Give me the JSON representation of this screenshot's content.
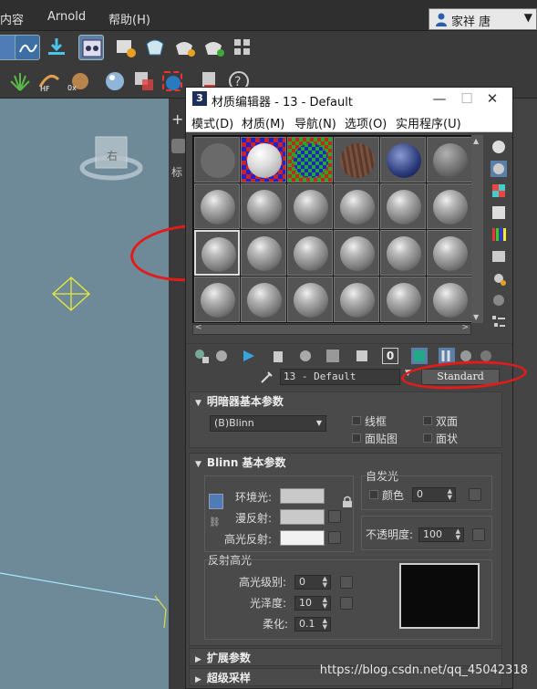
{
  "app_menu": {
    "items": [
      "内容",
      "Arnold",
      "帮助(H)"
    ]
  },
  "user": {
    "name": "家祥 唐",
    "icon": "user-icon",
    "caret": "▼"
  },
  "toolbar1": {
    "icons": [
      "schematic-view-icon",
      "curve-editor-icon",
      "layer-explorer-icon",
      "material-editor-icon",
      "render-setup-icon",
      "rendered-frame-window-icon",
      "render-icon",
      "render-iterative-icon",
      "render-to-texture-icon"
    ]
  },
  "toolbar2": {
    "icons": [
      "foliage-icon",
      "hair-fur-icon",
      "cloth-icon",
      "sphere-material-icon",
      "material-map-icon",
      "render-sphere-icon",
      "box-select-icon",
      "batch-render-icon",
      "help-icon"
    ]
  },
  "viewport": {
    "cube_label": "右"
  },
  "material_editor": {
    "title": "材质编辑器 - 13 - Default",
    "app_icon_text": "3",
    "window_controls": {
      "minimize": "—",
      "maximize": "☐",
      "close": "✕"
    },
    "menu": [
      "模式(D)",
      "材质(M)",
      "导航(N)",
      "选项(O)",
      "实用程序(U)"
    ],
    "material_name": "13 - Default",
    "material_type": "Standard",
    "shader_section": {
      "title": "明暗器基本参数",
      "shader_value": "(B)Blinn",
      "checkboxes": [
        "线框",
        "双面",
        "面贴图",
        "面状"
      ]
    },
    "blinn_section": {
      "title": "Blinn 基本参数",
      "ambient_label": "环境光:",
      "diffuse_label": "漫反射:",
      "specular_label": "高光反射:",
      "self_illum_title": "自发光",
      "color_label": "颜色",
      "color_value": "0",
      "opacity_label": "不透明度:",
      "opacity_value": "100",
      "spec_highlights_title": "反射高光",
      "spec_level_label": "高光级别:",
      "spec_level_value": "0",
      "glossiness_label": "光泽度:",
      "glossiness_value": "10",
      "soften_label": "柔化:",
      "soften_value": "0.1"
    },
    "extended_section": {
      "title": "扩展参数"
    },
    "supersampling_section": {
      "title": "超级采样"
    }
  },
  "watermark": "https://blog.csdn.net/qq_45042318",
  "colors": {
    "annotation_red": "#e21b1b",
    "viewport_bg": "#6e8a98",
    "panel_bg": "#444444"
  }
}
